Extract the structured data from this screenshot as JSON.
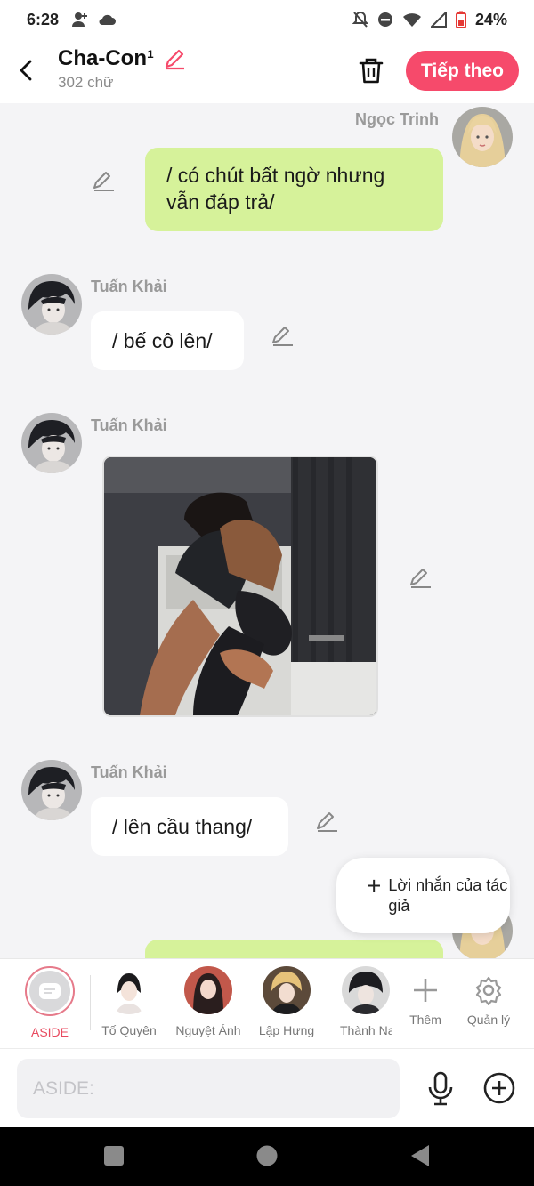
{
  "status_bar": {
    "time": "6:28",
    "battery": "24%"
  },
  "header": {
    "title": "Cha-Con¹",
    "word_count": "302 chữ",
    "next_label": "Tiếp theo"
  },
  "messages": [
    {
      "sender": "Ngọc Trinh",
      "text": "/ có chút bất ngờ nhưng vẫn đáp trả/",
      "side": "right"
    },
    {
      "sender": "Tuấn Khải",
      "text": "/ bế cô lên/",
      "side": "left"
    },
    {
      "sender": "Tuấn Khải",
      "type": "image",
      "side": "left"
    },
    {
      "sender": "Tuấn Khải",
      "text": "/ lên cầu thang/",
      "side": "left"
    }
  ],
  "author_note": {
    "label": "Lời nhắn của tác giả"
  },
  "characters": [
    {
      "name": "ASIDE",
      "color": "#e84a5f"
    },
    {
      "name": "Tố Quyên"
    },
    {
      "name": "Nguyệt Ánh"
    },
    {
      "name": "Lập Hưng"
    },
    {
      "name": "Thành Na"
    },
    {
      "name": "Thêm",
      "icon": "plus-icon"
    },
    {
      "name": "Quản lý",
      "icon": "gear-icon"
    }
  ],
  "input": {
    "placeholder": "ASIDE:"
  },
  "colors": {
    "accent": "#f64a6b",
    "green_bubble": "#d6f29a",
    "background": "#f4f4f6"
  }
}
